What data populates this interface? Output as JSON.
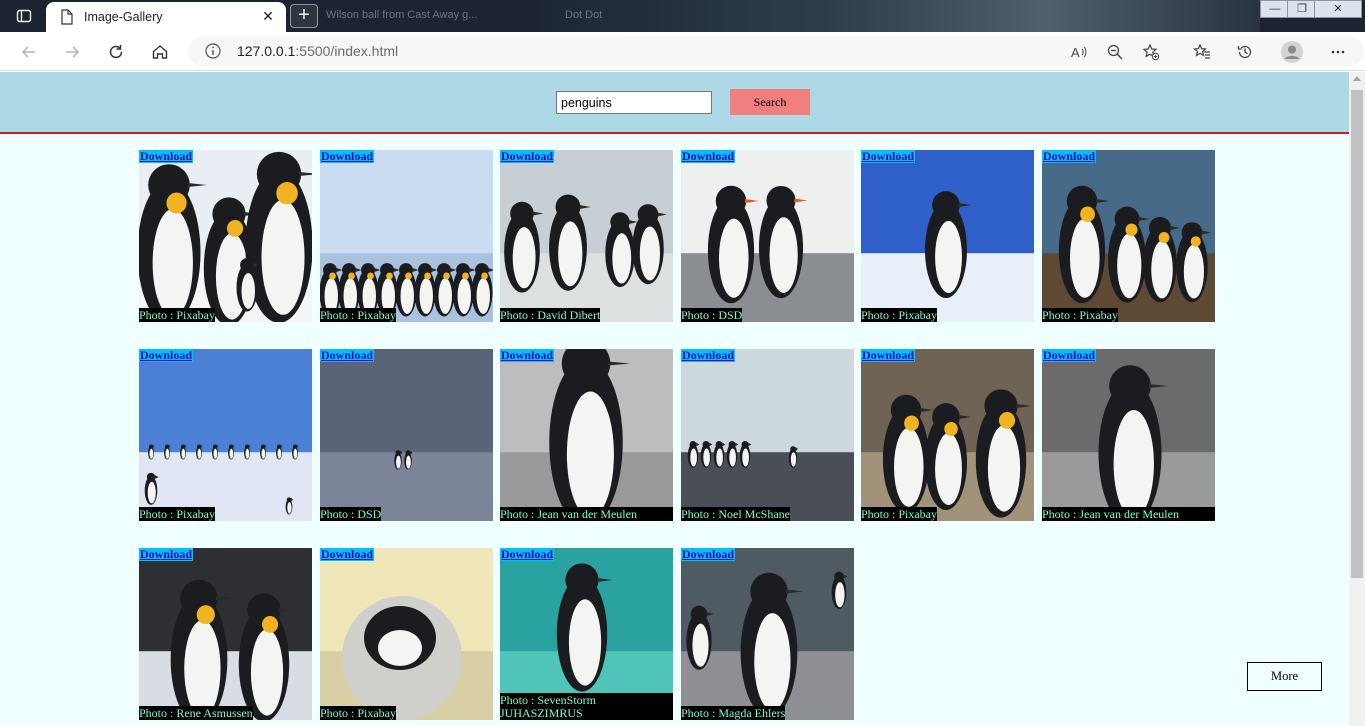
{
  "browser": {
    "tab_title": "Image-Gallery",
    "ghost_tabs": [
      "Wilson ball from Cast Away g...",
      "Dot Dot"
    ],
    "url_host": "127.0.0.1",
    "url_rest": ":5500/index.html"
  },
  "search": {
    "value": "penguins",
    "button_label": "Search"
  },
  "gallery": {
    "download_label": "Download",
    "cards": [
      {
        "credit": "Photo : Pixabay",
        "scene": "emperor-colony",
        "sky": "#e8eef3",
        "ground": "#f3f5f7"
      },
      {
        "credit": "Photo : Pixabay",
        "scene": "iceberg-crowd",
        "sky": "#c9dcf1",
        "ground": "#a9c3df"
      },
      {
        "credit": "Photo : David Dibert",
        "scene": "beach-group",
        "sky": "#c8cfd4",
        "ground": "#dde0e0"
      },
      {
        "credit": "Photo : DSD",
        "scene": "gentoo-pair",
        "sky": "#eef0f0",
        "ground": "#8a8d91"
      },
      {
        "credit": "Photo : Pixabay",
        "scene": "adelie-wings",
        "sky": "#2f5fc9",
        "ground": "#e9eff8"
      },
      {
        "credit": "Photo : Pixabay",
        "scene": "king-group",
        "sky": "#466a87",
        "ground": "#5e4a34"
      },
      {
        "credit": "Photo : Pixabay",
        "scene": "ice-shelf",
        "sky": "#4c7fd6",
        "ground": "#dfe5f3"
      },
      {
        "credit": "Photo : DSD",
        "scene": "pair-distant",
        "sky": "#5b6378",
        "ground": "#7c849a"
      },
      {
        "credit": "Photo : Jean van der Meulen",
        "scene": "bw-closeup",
        "sky": "#bdbdbd",
        "ground": "#9a9a9a"
      },
      {
        "credit": "Photo : Noel McShane",
        "scene": "rock-silhouettes",
        "sky": "#cdd8de",
        "ground": "#4a4f55"
      },
      {
        "credit": "Photo : Pixabay",
        "scene": "king-rock",
        "sky": "#6e6354",
        "ground": "#a3927a"
      },
      {
        "credit": "Photo : Jean van der Meulen",
        "scene": "bw-wings",
        "sky": "#6b6b6b",
        "ground": "#9a9a9a"
      },
      {
        "credit": "Photo : Rene Asmussen",
        "scene": "king-pair",
        "sky": "#2e2f35",
        "ground": "#d8dde4"
      },
      {
        "credit": "Photo : Pixabay",
        "scene": "chick",
        "sky": "#efe7b8",
        "ground": "#d8d0a4"
      },
      {
        "credit": "Photo : SevenStorm JUHASZIMRUS",
        "scene": "beach-water",
        "sky": "#2aa3a0",
        "ground": "#4fc4b8"
      },
      {
        "credit": "Photo : Magda Ehlers",
        "scene": "african-rocks",
        "sky": "#4f5b63",
        "ground": "#8d8f94"
      }
    ]
  },
  "more_label": "More",
  "colors": {
    "header_bg": "#add8e6",
    "header_border": "#c0202a",
    "page_bg": "#f0ffff",
    "search_button": "#f08080",
    "download_bg": "#00bfff",
    "credit_text": "#7fffd4"
  }
}
